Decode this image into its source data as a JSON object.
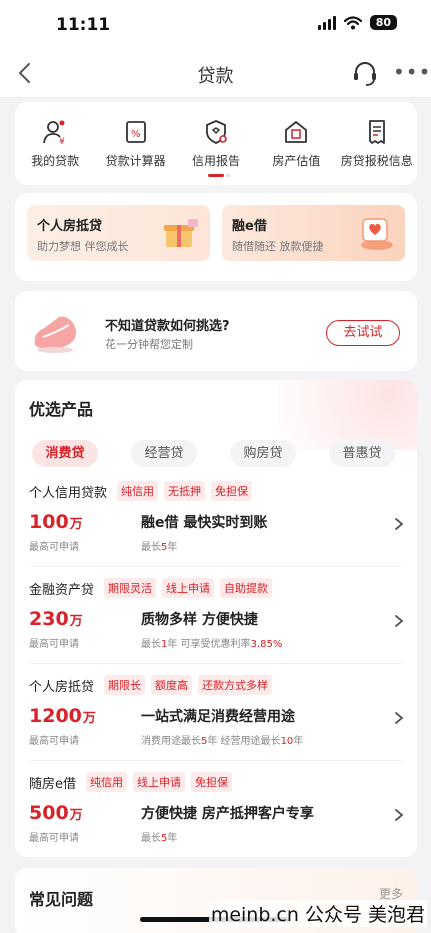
{
  "status_bar": {
    "time": "11:11",
    "battery": "80"
  },
  "nav": {
    "title": "贷款"
  },
  "quick_menu": [
    {
      "label": "我的贷款",
      "icon": "person-loan-icon"
    },
    {
      "label": "贷款计算器",
      "icon": "calculator-icon"
    },
    {
      "label": "信用报告",
      "icon": "credit-report-icon"
    },
    {
      "label": "房产估值",
      "icon": "house-valuation-icon"
    },
    {
      "label": "房贷报税信息",
      "icon": "tax-document-icon"
    }
  ],
  "promos": [
    {
      "title": "个人房抵贷",
      "subtitle": "助力梦想 伴您成长"
    },
    {
      "title": "融e借",
      "subtitle": "随借随还 放款便捷"
    }
  ],
  "advisor": {
    "title": "不知道贷款如何挑选?",
    "subtitle": "花一分钟帮您定制",
    "button": "去试试"
  },
  "products_section": {
    "title": "优选产品",
    "tabs": [
      "消费贷",
      "经营贷",
      "购房贷",
      "普惠贷"
    ],
    "active_tab": "消费贷",
    "items": [
      {
        "name": "个人信用贷款",
        "tags": [
          "纯信用",
          "无抵押",
          "免担保"
        ],
        "amount": "100",
        "unit": "万",
        "amount_label": "最高可申请",
        "headline": "融e借 最快实时到账",
        "detail_parts": [
          {
            "t": "最长"
          },
          {
            "t": "5",
            "hl": true
          },
          {
            "t": "年"
          }
        ]
      },
      {
        "name": "金融资产贷",
        "tags": [
          "期限灵活",
          "线上申请",
          "自助提款"
        ],
        "amount": "230",
        "unit": "万",
        "amount_label": "最高可申请",
        "headline": "质物多样 方便快捷",
        "detail_parts": [
          {
            "t": "最长"
          },
          {
            "t": "1",
            "hl": true
          },
          {
            "t": "年  可享受优惠利率"
          },
          {
            "t": "3.85%",
            "hl": true
          }
        ]
      },
      {
        "name": "个人房抵贷",
        "tags": [
          "期限长",
          "额度高",
          "还款方式多样"
        ],
        "amount": "1200",
        "unit": "万",
        "amount_label": "最高可申请",
        "headline": "一站式满足消费经营用途",
        "detail_parts": [
          {
            "t": "消费用途最长"
          },
          {
            "t": "5",
            "hl": true
          },
          {
            "t": "年  经营用途最长"
          },
          {
            "t": "10",
            "hl": true
          },
          {
            "t": "年"
          }
        ]
      },
      {
        "name": "随房e借",
        "tags": [
          "纯信用",
          "线上申请",
          "免担保"
        ],
        "amount": "500",
        "unit": "万",
        "amount_label": "最高可申请",
        "headline": "方便快捷 房产抵押客户专享",
        "detail_parts": [
          {
            "t": "最长"
          },
          {
            "t": "5",
            "hl": true
          },
          {
            "t": "年"
          }
        ]
      }
    ]
  },
  "faq": {
    "title": "常见问题",
    "more": "更多"
  },
  "watermark": "meinb.cn 公众号 美泡君",
  "colors": {
    "accent": "#d8232a",
    "background": "#f3f3f5"
  }
}
